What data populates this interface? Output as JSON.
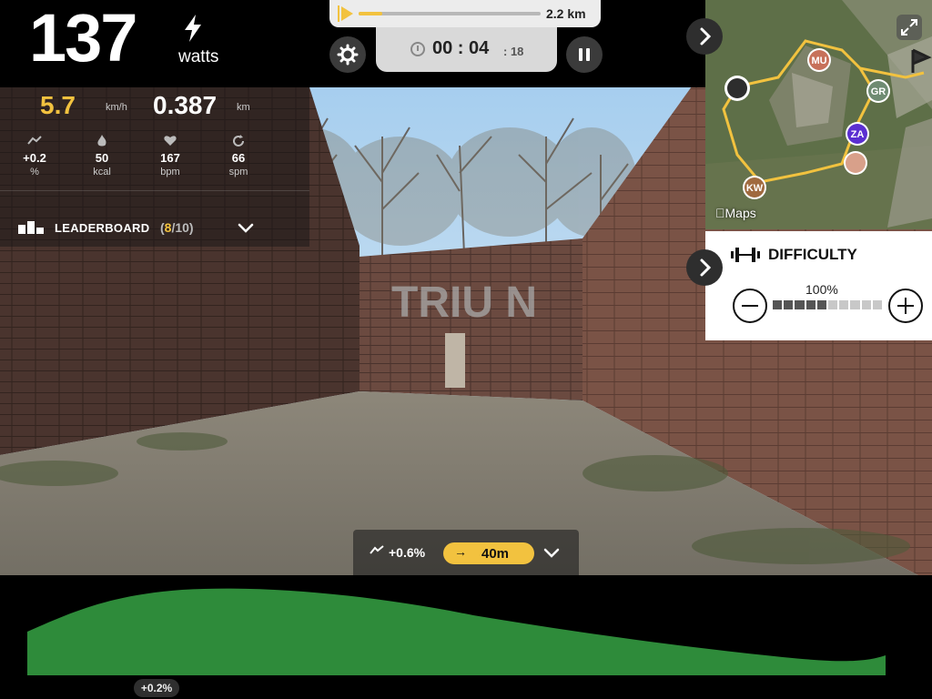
{
  "power": {
    "value": "137",
    "unit": "watts",
    "icon": "bolt-icon"
  },
  "progress": {
    "distance": "2.2 km",
    "fraction": 0.13
  },
  "timer": {
    "main": "00 : 04",
    "seconds": ": 18"
  },
  "stats": {
    "speed": {
      "value": "5.7",
      "unit": "km/h"
    },
    "distance": {
      "value": "0.387",
      "unit": "km"
    },
    "metrics": [
      {
        "icon": "grade-icon",
        "value": "+0.2",
        "unit": "%"
      },
      {
        "icon": "flame-icon",
        "value": "50",
        "unit": "kcal"
      },
      {
        "icon": "heart-icon",
        "value": "167",
        "unit": "bpm"
      },
      {
        "icon": "cadence-icon",
        "value": "66",
        "unit": "spm"
      }
    ]
  },
  "leaderboard": {
    "label": "LEADERBOARD",
    "open": "(",
    "current": "8",
    "total": "/10)"
  },
  "map": {
    "attribution": "Maps",
    "riders": [
      "MU",
      "GR",
      "ZA",
      "KW"
    ],
    "colors": {
      "route": "#f2c23f",
      "MU": "#c7715a",
      "GR": "#6f8b72",
      "ZA": "#5b2fd1",
      "KW": "#a06a3f"
    }
  },
  "difficulty": {
    "title": "DIFFICULTY",
    "percent": "100%",
    "level": 1.0
  },
  "grade": {
    "value": "+0.6%",
    "arrow": "→",
    "distance": "40m"
  },
  "elevation": {
    "badge": "+0.2%",
    "color": "#2e8b3a"
  },
  "colors": {
    "accent": "#f2c23f",
    "elevation": "#2e8b3a"
  }
}
